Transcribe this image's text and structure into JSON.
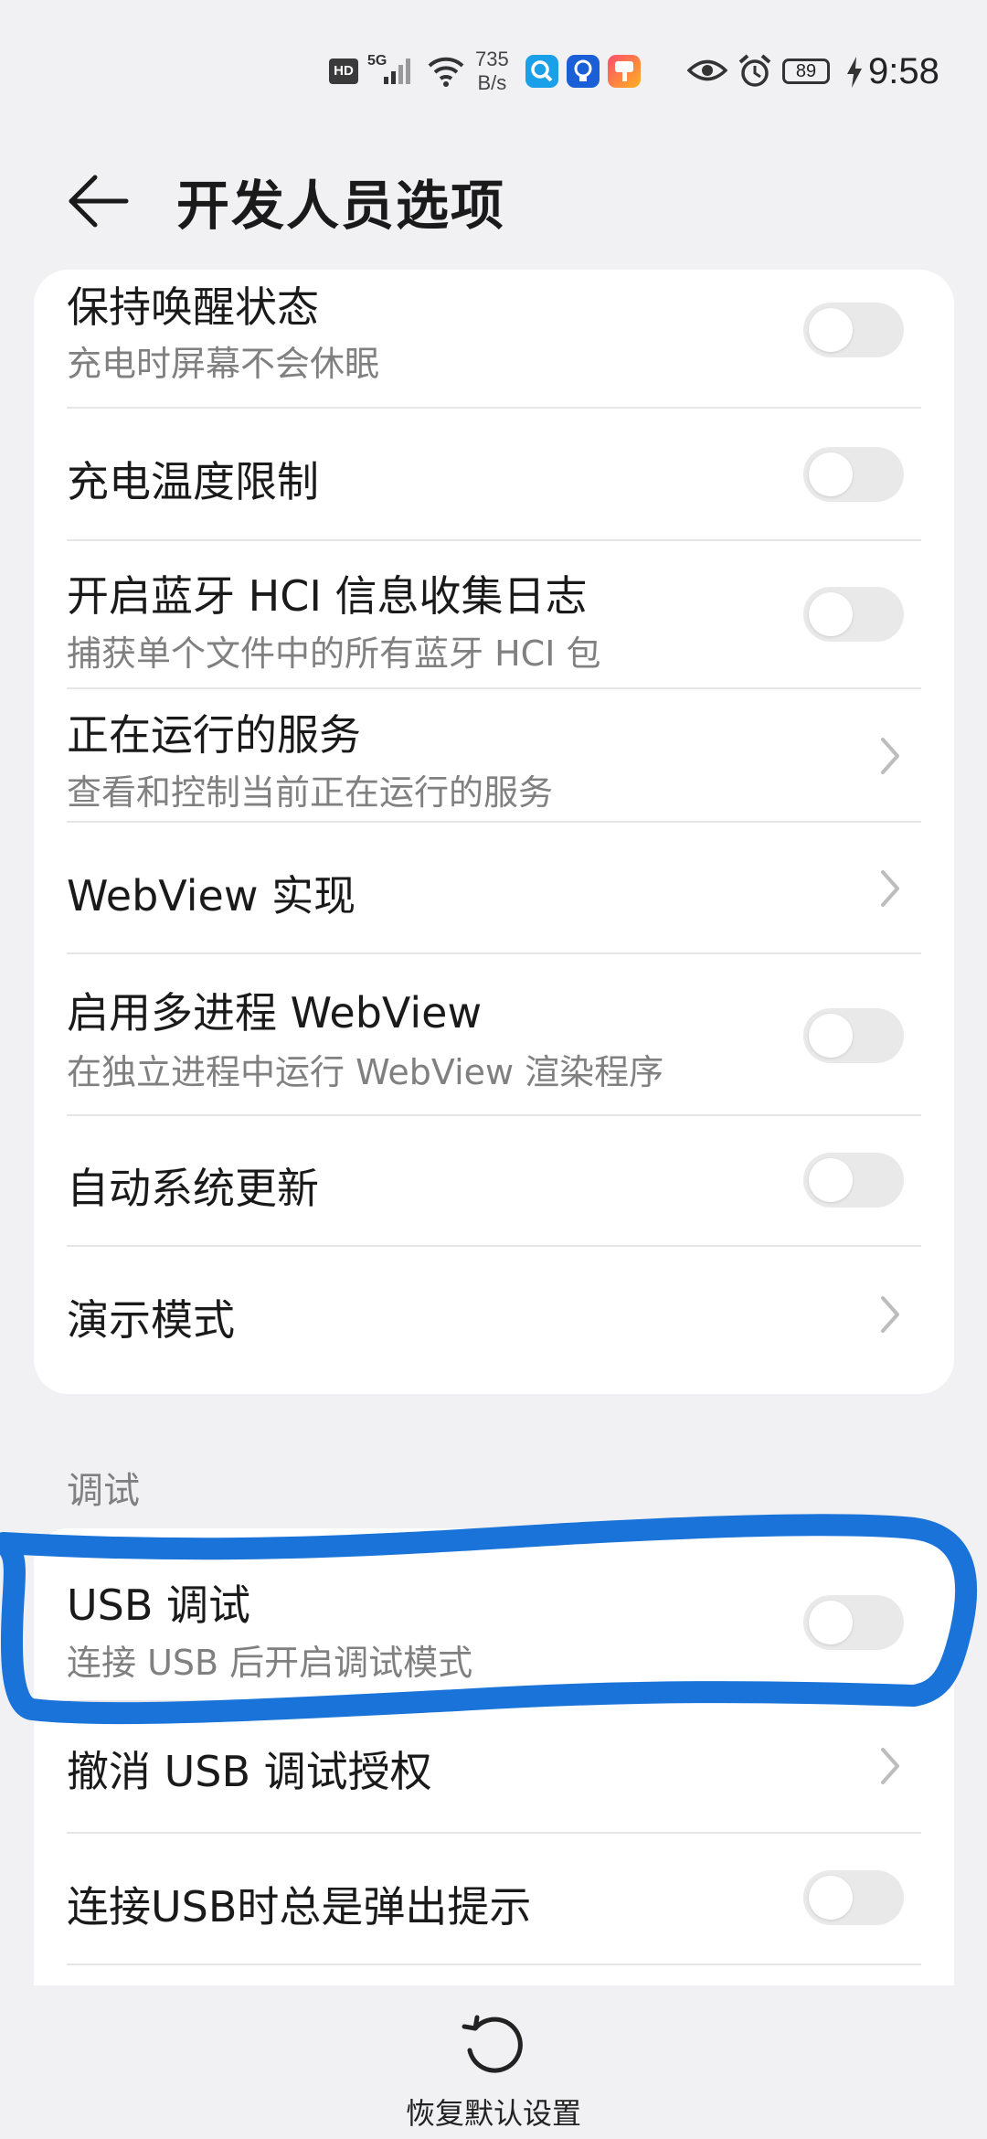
{
  "status_bar": {
    "hd": "HD",
    "network": "5G",
    "net_speed_value": "735",
    "net_speed_unit": "B/s",
    "battery": "89",
    "time": "9:58"
  },
  "header": {
    "title": "开发人员选项"
  },
  "section1": {
    "items": [
      {
        "title": "保持唤醒状态",
        "subtitle": "充电时屏幕不会休眠",
        "control": "toggle",
        "on": false
      },
      {
        "title": "充电温度限制",
        "control": "toggle",
        "on": false
      },
      {
        "title": "开启蓝牙 HCI 信息收集日志",
        "subtitle": "捕获单个文件中的所有蓝牙 HCI 包",
        "control": "toggle",
        "on": false
      },
      {
        "title": "正在运行的服务",
        "subtitle": "查看和控制当前正在运行的服务",
        "control": "chevron"
      },
      {
        "title": "WebView 实现",
        "control": "chevron"
      },
      {
        "title": "启用多进程 WebView",
        "subtitle": "在独立进程中运行 WebView 渲染程序",
        "control": "toggle",
        "on": false
      },
      {
        "title": "自动系统更新",
        "control": "toggle",
        "on": false
      },
      {
        "title": "演示模式",
        "control": "chevron"
      }
    ]
  },
  "section2": {
    "label": "调试",
    "items": [
      {
        "title": "USB 调试",
        "subtitle": "连接 USB 后开启调试模式",
        "control": "toggle",
        "on": false
      },
      {
        "title": "撤消 USB 调试授权",
        "control": "chevron"
      },
      {
        "title": "连接USB时总是弹出提示",
        "control": "toggle",
        "on": false
      }
    ]
  },
  "bottom": {
    "reset_label": "恢复默认设置"
  },
  "colors": {
    "background": "#f1f1f3",
    "card": "#ffffff",
    "toggle_off": "#e9e9e9",
    "annotation": "#1a73d9"
  }
}
